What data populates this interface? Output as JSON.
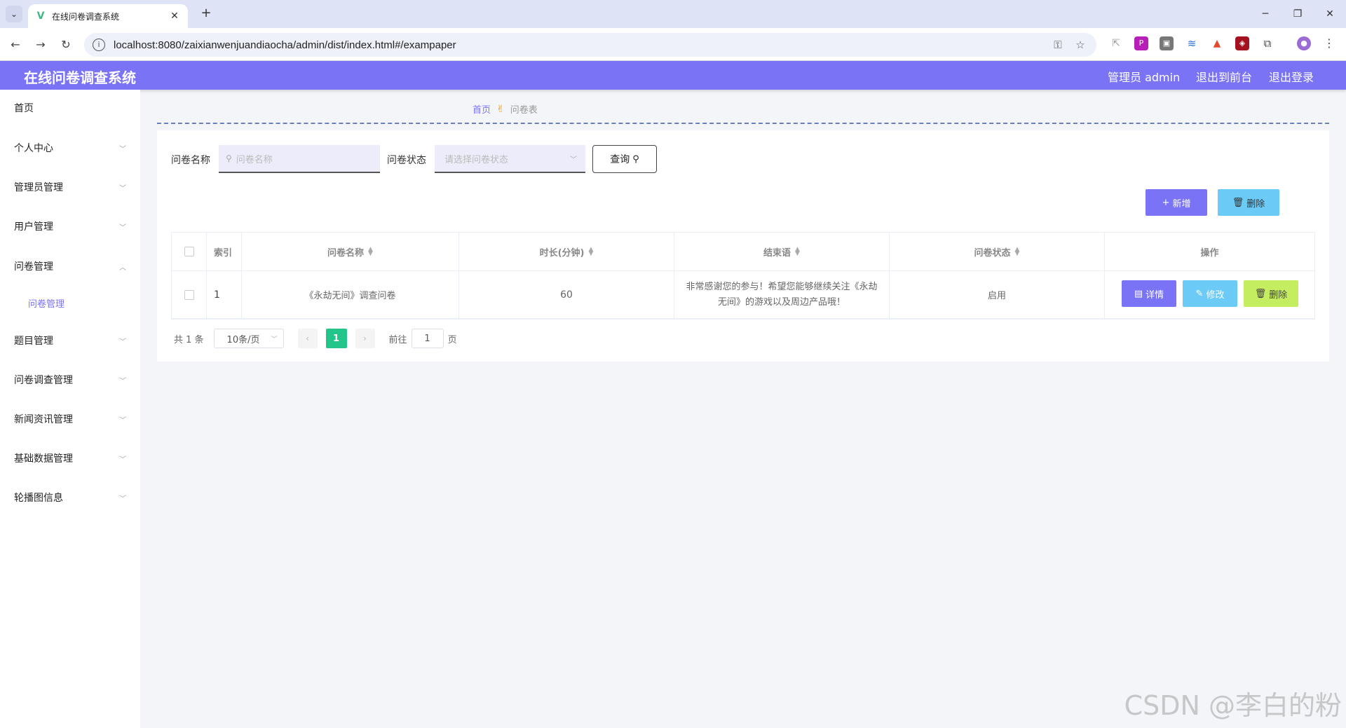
{
  "browser": {
    "tab_title": "在线问卷调查系统",
    "url": "localhost:8080/zaixianwenjuandiaocha/admin/dist/index.html#/exampaper"
  },
  "header": {
    "title": "在线问卷调查系统",
    "user": "管理员 admin",
    "to_front": "退出到前台",
    "logout": "退出登录"
  },
  "sidebar": {
    "items": [
      {
        "label": "首页"
      },
      {
        "label": "个人中心"
      },
      {
        "label": "管理员管理"
      },
      {
        "label": "用户管理"
      },
      {
        "label": "问卷管理"
      },
      {
        "label": "题目管理"
      },
      {
        "label": "问卷调查管理"
      },
      {
        "label": "新闻资讯管理"
      },
      {
        "label": "基础数据管理"
      },
      {
        "label": "轮播图信息"
      }
    ],
    "sub_item": "问卷管理"
  },
  "breadcrumb": {
    "home": "首页",
    "current": "问卷表"
  },
  "filters": {
    "name_label": "问卷名称",
    "name_placeholder": "问卷名称",
    "status_label": "问卷状态",
    "status_placeholder": "请选择问卷状态",
    "query_label": "查询"
  },
  "actions": {
    "add": "新增",
    "delete": "删除"
  },
  "table": {
    "headers": [
      "索引",
      "问卷名称",
      "时长(分钟)",
      "结束语",
      "问卷状态",
      "操作"
    ],
    "rows": [
      {
        "index": "1",
        "name": "《永劫无间》调查问卷",
        "duration": "60",
        "closing": "非常感谢您的参与！希望您能够继续关注《永劫无间》的游戏以及周边产品哦！",
        "status": "启用",
        "ops": {
          "detail": "详情",
          "edit": "修改",
          "delete": "删除"
        }
      }
    ]
  },
  "pagination": {
    "total": "共 1 条",
    "page_size": "10条/页",
    "current_page": "1",
    "goto_label": "前往",
    "goto_value": "1",
    "page_unit": "页"
  },
  "watermark": "CSDN @李白的粉"
}
